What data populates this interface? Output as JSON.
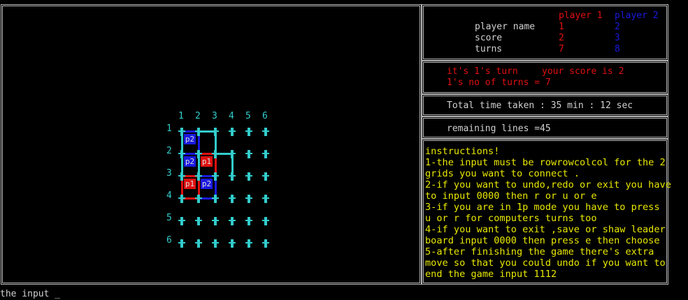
{
  "board": {
    "col_labels": [
      "1",
      "2",
      "3",
      "4",
      "5",
      "6"
    ],
    "row_labels": [
      "1",
      "2",
      "3",
      "4",
      "5",
      "6"
    ],
    "cells": [
      {
        "row": 1,
        "col": 1,
        "owner": "p2",
        "label": "p2"
      },
      {
        "row": 2,
        "col": 1,
        "owner": "p2",
        "label": "p2"
      },
      {
        "row": 2,
        "col": 2,
        "owner": "p1",
        "label": "p1"
      },
      {
        "row": 3,
        "col": 1,
        "owner": "p1",
        "label": "p1"
      },
      {
        "row": 3,
        "col": 2,
        "owner": "p2",
        "label": "p2"
      }
    ]
  },
  "scoreboard": {
    "header_p1": "player 1",
    "header_p2": "player 2",
    "rows": [
      {
        "label": "player name",
        "p1": "1",
        "p2": "2"
      },
      {
        "label": "score",
        "p1": "2",
        "p2": "3"
      },
      {
        "label": "turns",
        "p1": "7",
        "p2": "8"
      }
    ]
  },
  "status": {
    "turn_text": "it's 1's turn",
    "score_text": "your score is 2",
    "turns_text": "1's no of turns = 7"
  },
  "time": {
    "text": "Total time taken : 35 min : 12 sec"
  },
  "remaining": {
    "text": "remaining lines =45"
  },
  "instructions": [
    "instructions!",
    "1-the input must be rowrowcolcol for the 2",
    "grids you want to connect .",
    "2-if you want to undo,redo or exit you have",
    "to input 0000 then r or u or e",
    "3-if you are in 1p mode you have to press",
    "u or r for computers turns too",
    "4-if you want to exit ,save or shaw leader",
    "board input 0000 then press e then choose",
    "5-after finishing the game there's extra",
    "move so that you could undo if you want to",
    "end the game input 1112"
  ],
  "prompt": {
    "text": "the input _"
  },
  "colors": {
    "cyan": "#33cccc",
    "player1": "#e01010",
    "player2": "#1a1ae0",
    "instructions": "#e8e800"
  }
}
